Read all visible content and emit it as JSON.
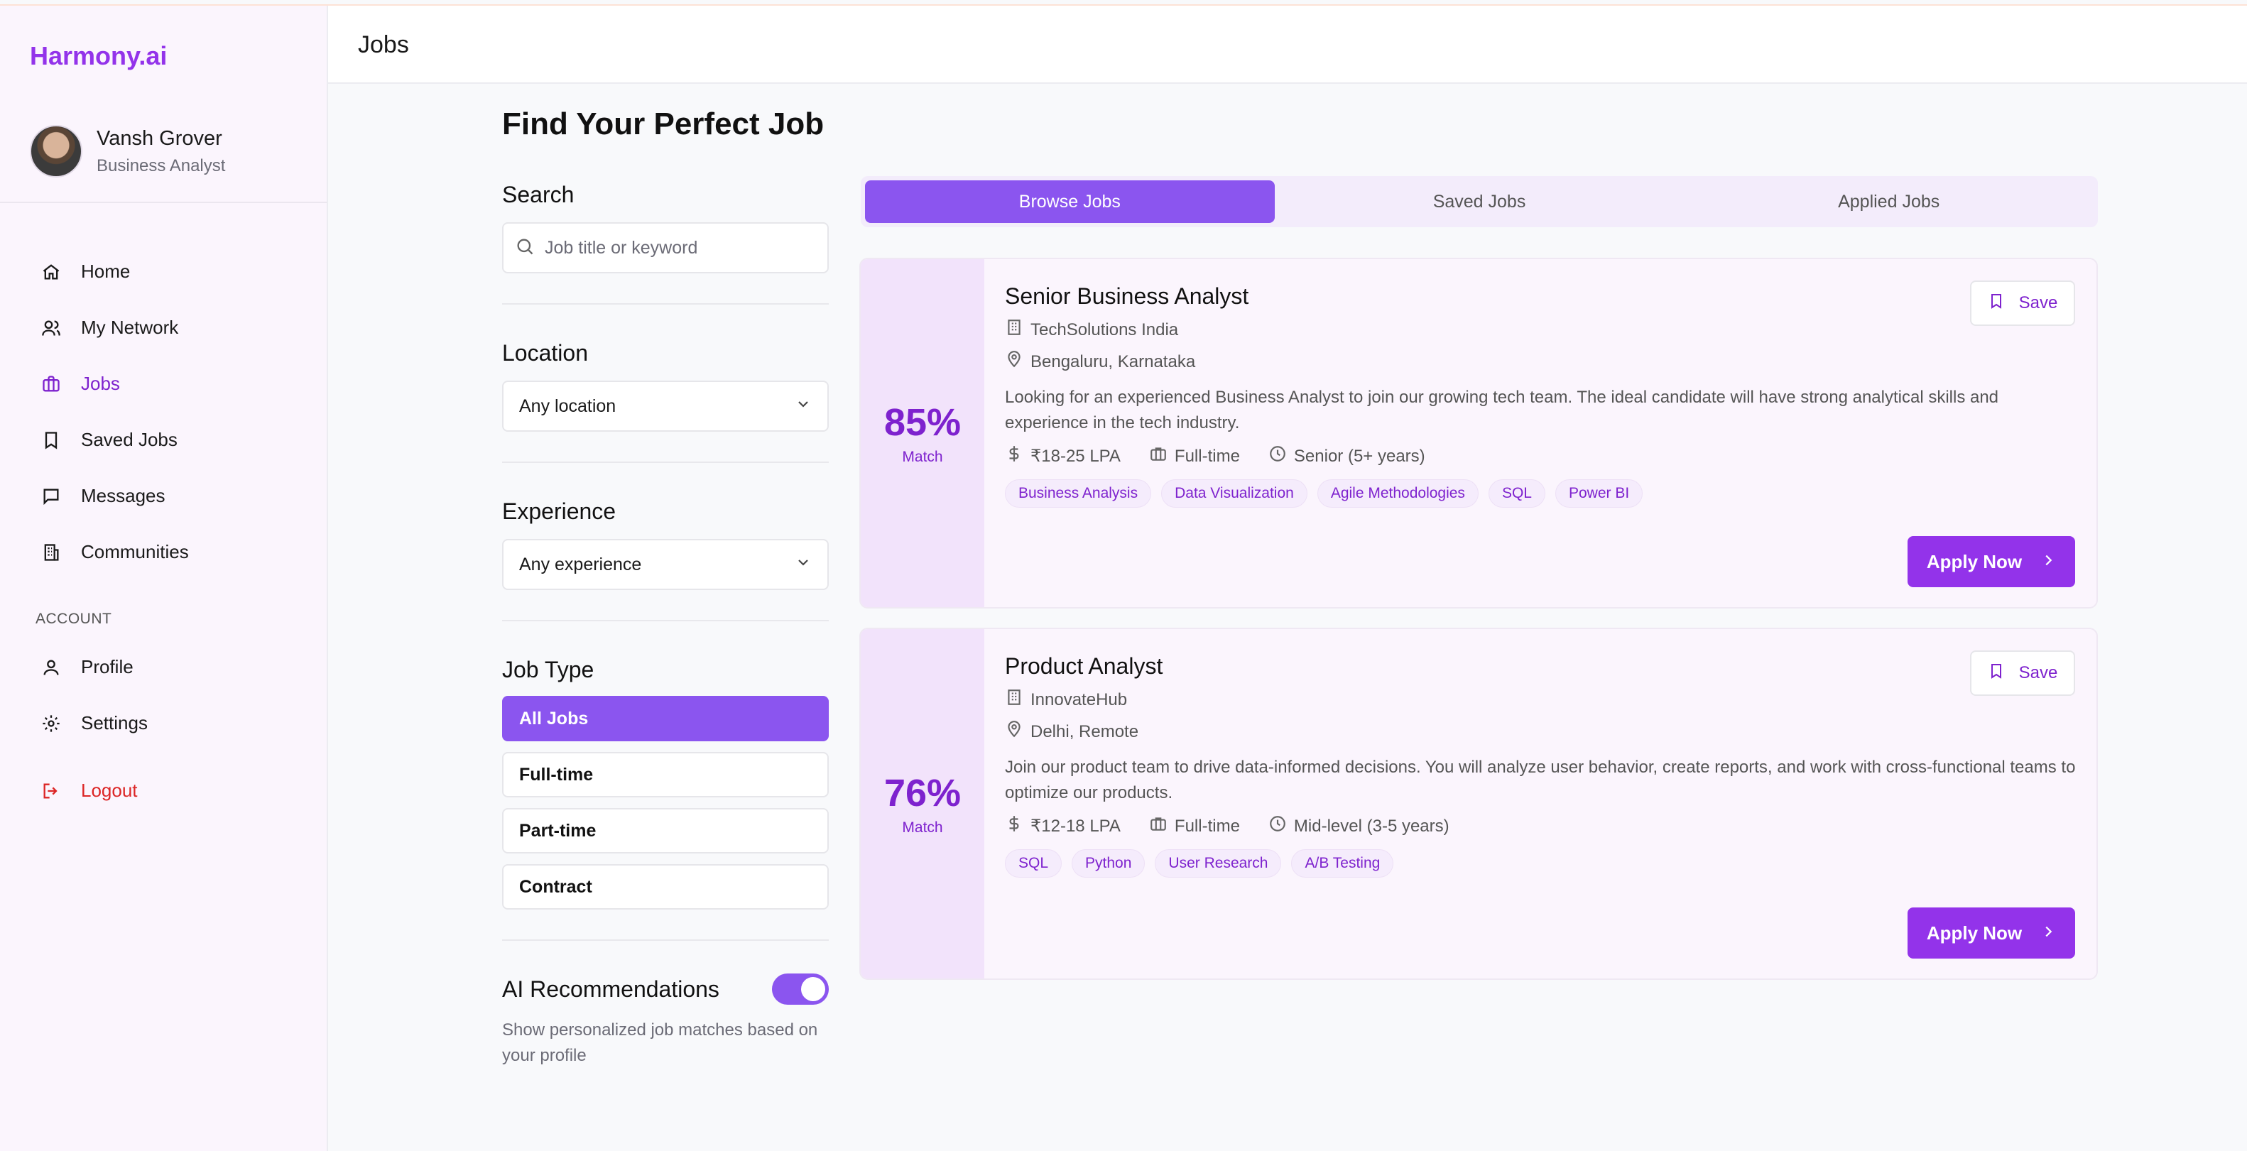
{
  "brand": "Harmony.ai",
  "user": {
    "name": "Vansh Grover",
    "role": "Business Analyst"
  },
  "nav": [
    {
      "label": "Home",
      "icon": "home-icon"
    },
    {
      "label": "My Network",
      "icon": "users-icon"
    },
    {
      "label": "Jobs",
      "icon": "briefcase-icon",
      "active": true
    },
    {
      "label": "Saved Jobs",
      "icon": "bookmark-icon"
    },
    {
      "label": "Messages",
      "icon": "message-icon"
    },
    {
      "label": "Communities",
      "icon": "building-icon"
    }
  ],
  "account": {
    "heading": "ACCOUNT",
    "items": [
      {
        "label": "Profile",
        "icon": "user-icon"
      },
      {
        "label": "Settings",
        "icon": "gear-icon"
      }
    ],
    "logout": "Logout"
  },
  "header": {
    "title": "Jobs"
  },
  "page_title": "Find Your Perfect Job",
  "filters": {
    "search_label": "Search",
    "search_placeholder": "Job title or keyword",
    "location_label": "Location",
    "location_value": "Any location",
    "experience_label": "Experience",
    "experience_value": "Any experience",
    "job_type_label": "Job Type",
    "job_types": [
      "All Jobs",
      "Full-time",
      "Part-time",
      "Contract"
    ],
    "job_type_selected": "All Jobs",
    "ai_label": "AI Recommendations",
    "ai_enabled": true,
    "ai_desc": "Show personalized job matches based on your profile"
  },
  "tabs": [
    "Browse Jobs",
    "Saved Jobs",
    "Applied Jobs"
  ],
  "active_tab": "Browse Jobs",
  "jobs": [
    {
      "match": "85%",
      "match_label": "Match",
      "title": "Senior Business Analyst",
      "company": "TechSolutions India",
      "location": "Bengaluru, Karnataka",
      "description": "Looking for an experienced Business Analyst to join our growing tech team. The ideal candidate will have strong analytical skills and experience in the tech industry.",
      "salary": "₹18-25 LPA",
      "type": "Full-time",
      "level": "Senior (5+ years)",
      "tags": [
        "Business Analysis",
        "Data Visualization",
        "Agile Methodologies",
        "SQL",
        "Power BI"
      ],
      "save_label": "Save",
      "apply_label": "Apply Now"
    },
    {
      "match": "76%",
      "match_label": "Match",
      "title": "Product Analyst",
      "company": "InnovateHub",
      "location": "Delhi, Remote",
      "description": "Join our product team to drive data-informed decisions. You will analyze user behavior, create reports, and work with cross-functional teams to optimize our products.",
      "salary": "₹12-18 LPA",
      "type": "Full-time",
      "level": "Mid-level (3-5 years)",
      "tags": [
        "SQL",
        "Python",
        "User Research",
        "A/B Testing"
      ],
      "save_label": "Save",
      "apply_label": "Apply Now"
    }
  ],
  "colors": {
    "accent": "#9333ea",
    "accent_light": "#8b55ef",
    "danger": "#dc2626"
  }
}
